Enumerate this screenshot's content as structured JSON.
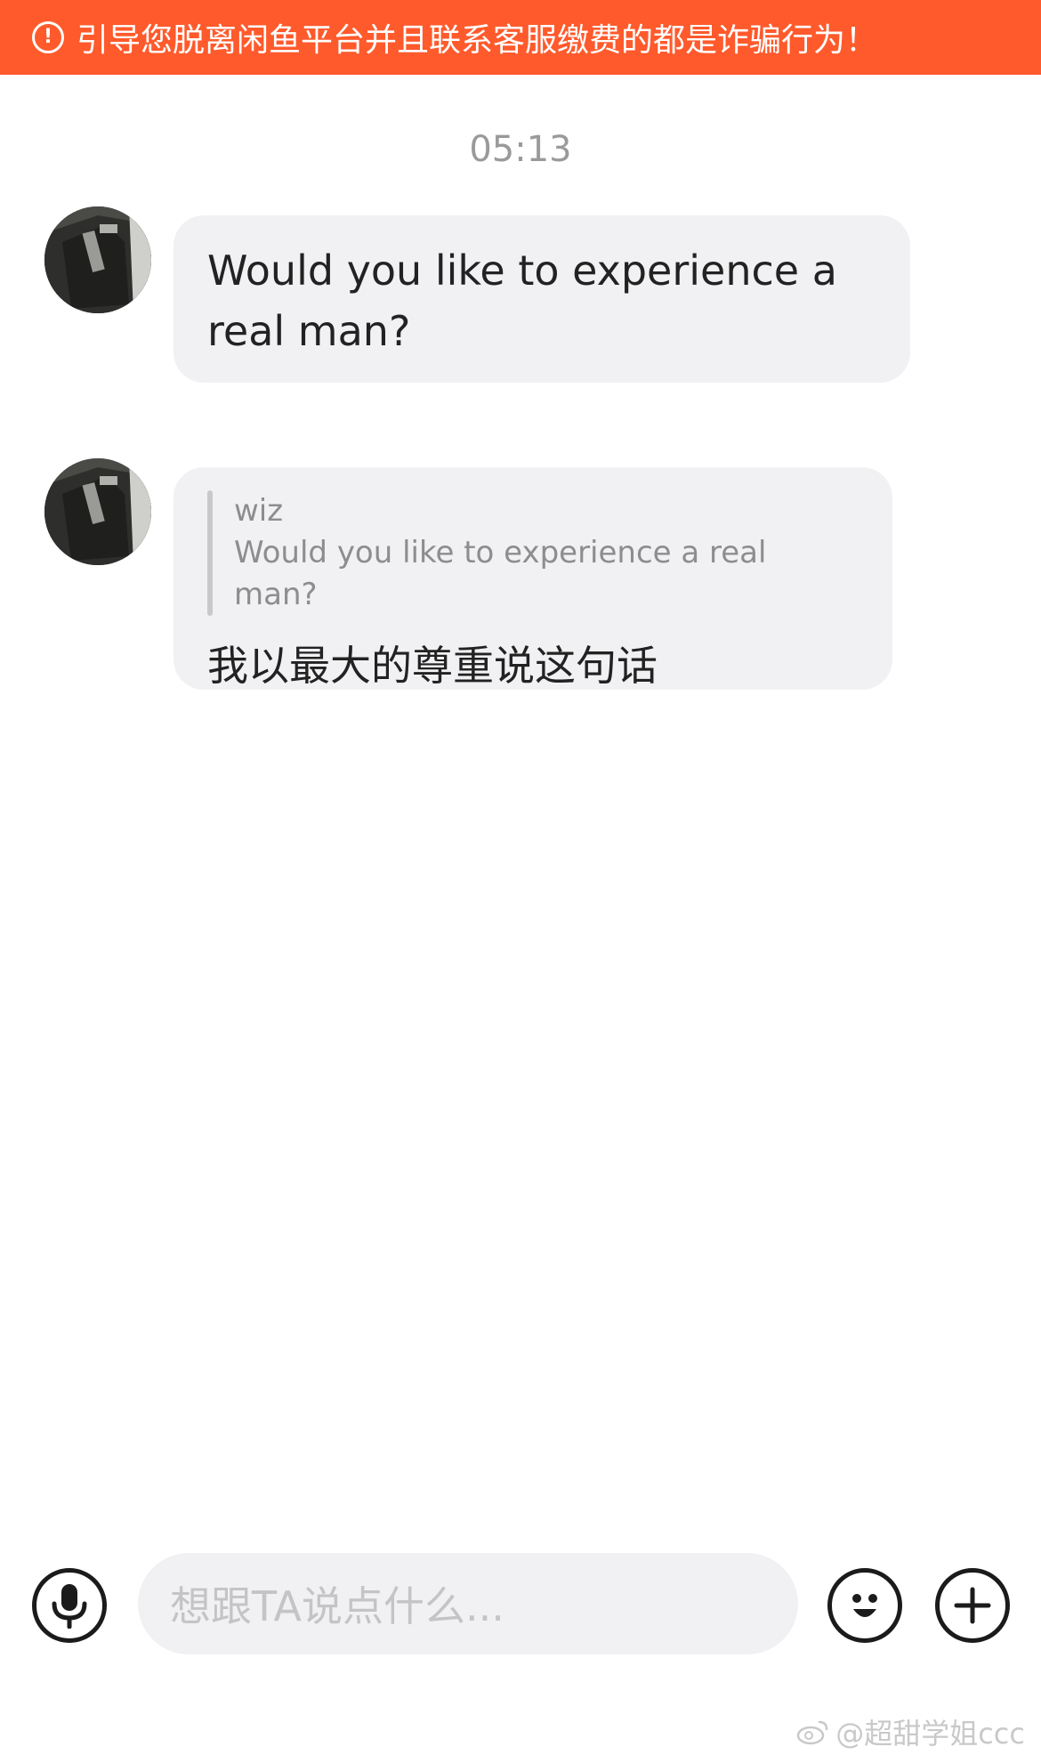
{
  "warning": {
    "icon": "exclamation-circle-icon",
    "text": "引导您脱离闲鱼平台并且联系客服缴费的都是诈骗行为！"
  },
  "chat": {
    "timestamp": "05:13",
    "messages": [
      {
        "text": "Would you like to experience a real man?"
      },
      {
        "quote_author": "wiz",
        "quote_text": "Would you like to experience a real man?",
        "text": "我以最大的尊重说这句话"
      }
    ]
  },
  "input_bar": {
    "placeholder": "想跟TA说点什么...",
    "icons": [
      "microphone-icon",
      "emoji-icon",
      "plus-icon"
    ]
  },
  "watermark": "@超甜学姐ccc",
  "colors": {
    "warning_bg": "#ff5a2c",
    "bubble_bg": "#f1f1f3",
    "input_bg": "#f1f1f3"
  }
}
